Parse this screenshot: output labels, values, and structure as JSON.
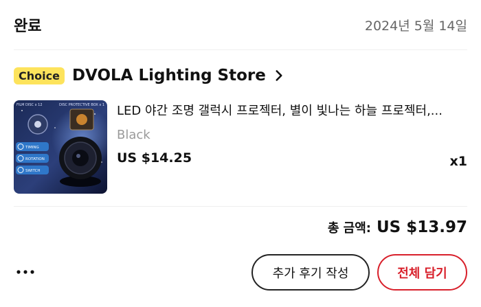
{
  "order": {
    "status": "완료",
    "date": "2024년 5월 14일"
  },
  "store": {
    "badge": "Choice",
    "name": "DVOLA Lighting Store",
    "chevron_icon": "chevron-right-icon"
  },
  "product": {
    "title": "LED 야간 조명 갤럭시 프로젝터, 별이 빛나는 하늘 프로젝터,...",
    "variant": "Black",
    "price": "US $14.25",
    "quantity": "x1",
    "thumbnail_labels": {
      "film": "FILM DISC x 12",
      "disc": "DISC PROTECTIVE BOX x 1",
      "timing": "TIMING",
      "rotation": "ROTATION",
      "switch": "SWITCH"
    }
  },
  "summary": {
    "total_label": "총 금액:",
    "total_amount": "US $13.97"
  },
  "actions": {
    "more_icon": "more-dots-icon",
    "review_label": "추가 후기 작성",
    "cart_label": "전체 담기"
  },
  "colors": {
    "choice_badge": "#fde35c",
    "accent_red": "#d81f2a",
    "muted_text": "#9a9a9a"
  }
}
